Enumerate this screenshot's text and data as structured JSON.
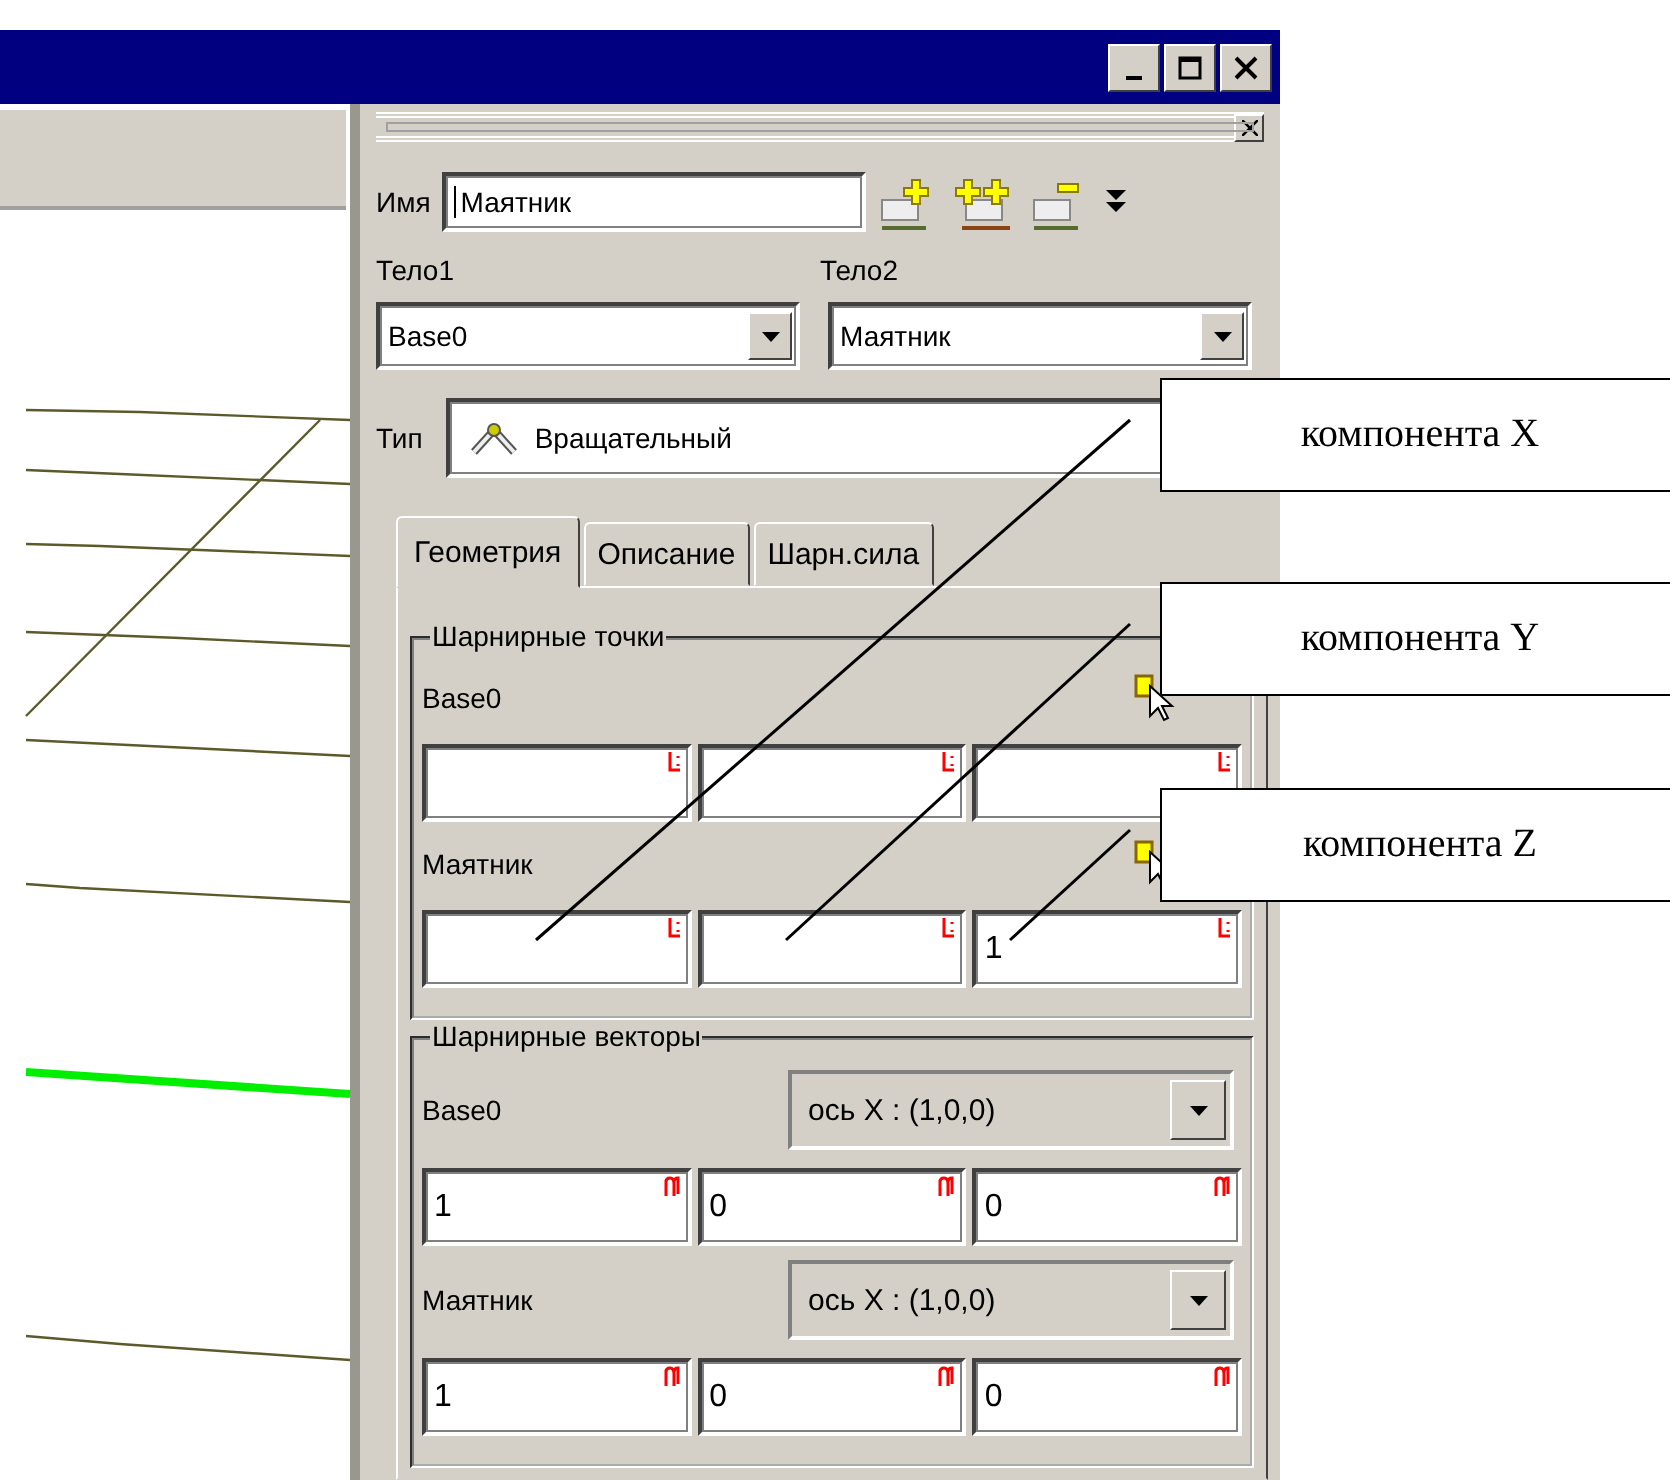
{
  "name_field": {
    "label": "Имя",
    "value": "Маятник"
  },
  "bodies": [
    {
      "label": "Тело1",
      "value": "Base0"
    },
    {
      "label": "Тело2",
      "value": "Маятник"
    }
  ],
  "type": {
    "label": "Тип",
    "value": "Вращательный"
  },
  "tabs": [
    {
      "label": "Геометрия",
      "selected": true
    },
    {
      "label": "Описание",
      "selected": false
    },
    {
      "label": "Шарн.сила",
      "selected": false
    }
  ],
  "groups": [
    {
      "title": "Шарнирные точки",
      "kind": "points",
      "rows": [
        {
          "label": "Base0",
          "fields": [
            {
              "kind": "empty"
            },
            {
              "kind": "empty"
            },
            {
              "kind": "empty"
            }
          ]
        },
        {
          "label": "Маятник",
          "fields": [
            {
              "kind": "empty"
            },
            {
              "kind": "empty"
            },
            {
              "kind": "value",
              "value": "1"
            }
          ]
        }
      ]
    },
    {
      "title": "Шарнирные векторы",
      "kind": "vectors",
      "rows": [
        {
          "label": "Base0",
          "axis": "ось X : (1,0,0)",
          "fields": [
            {
              "kind": "value",
              "value": "1"
            },
            {
              "kind": "value",
              "value": "0"
            },
            {
              "kind": "value",
              "value": "0"
            }
          ]
        },
        {
          "label": "Маятник",
          "axis": "ось X : (1,0,0)",
          "fields": [
            {
              "kind": "value",
              "value": "1"
            },
            {
              "kind": "value",
              "value": "0"
            },
            {
              "kind": "value",
              "value": "0"
            }
          ]
        }
      ]
    }
  ],
  "callouts": [
    {
      "text": "компонента X"
    },
    {
      "text": "компонента Y"
    },
    {
      "text": "компонента Z"
    }
  ]
}
